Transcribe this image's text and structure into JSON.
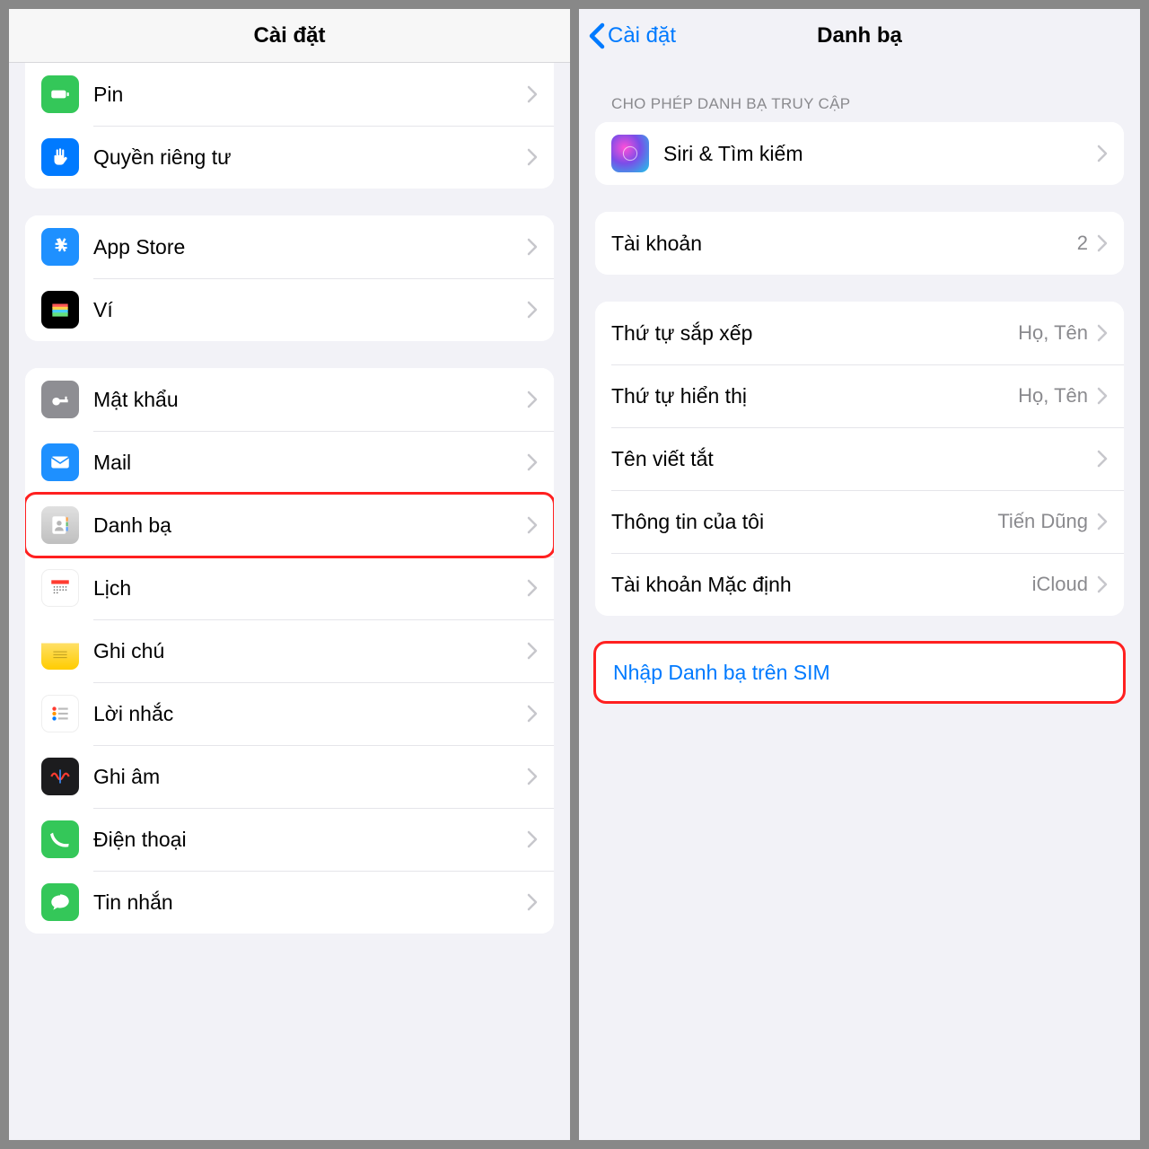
{
  "left": {
    "title": "Cài đặt",
    "group1": {
      "battery": "Pin",
      "privacy": "Quyền riêng tư"
    },
    "group2": {
      "appstore": "App Store",
      "wallet": "Ví"
    },
    "group3": {
      "passwords": "Mật khẩu",
      "mail": "Mail",
      "contacts": "Danh bạ",
      "calendar": "Lịch",
      "notes": "Ghi chú",
      "reminders": "Lời nhắc",
      "voicememos": "Ghi âm",
      "phone": "Điện thoại",
      "messages": "Tin nhắn"
    }
  },
  "right": {
    "back": "Cài đặt",
    "title": "Danh bạ",
    "access_header": "CHO PHÉP DANH BẠ TRUY CẬP",
    "siri": "Siri & Tìm kiếm",
    "accounts": {
      "label": "Tài khoản",
      "value": "2"
    },
    "sort_order": {
      "label": "Thứ tự sắp xếp",
      "value": "Họ, Tên"
    },
    "display_order": {
      "label": "Thứ tự hiển thị",
      "value": "Họ, Tên"
    },
    "short_name": "Tên viết tắt",
    "my_info": {
      "label": "Thông tin của tôi",
      "value": "Tiến Dũng"
    },
    "default_account": {
      "label": "Tài khoản Mặc định",
      "value": "iCloud"
    },
    "import_sim": "Nhập Danh bạ trên SIM"
  }
}
